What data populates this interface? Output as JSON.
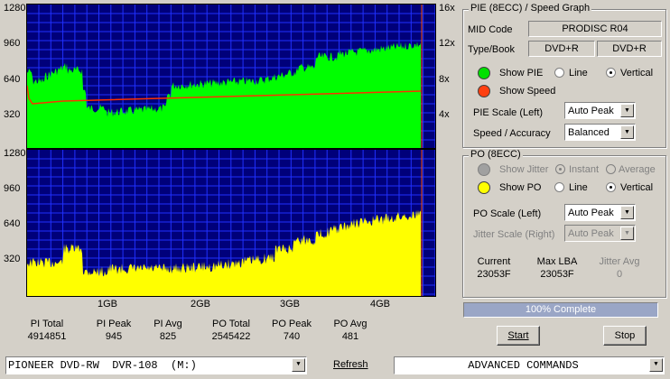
{
  "pie_chart": {
    "y_ticks": [
      "1280",
      "960",
      "640",
      "320"
    ],
    "speed_ticks": [
      "16x",
      "12x",
      "8x",
      "4x"
    ]
  },
  "po_chart": {
    "y_ticks": [
      "1280",
      "960",
      "640",
      "320"
    ]
  },
  "x_ticks": [
    "1GB",
    "2GB",
    "3GB",
    "4GB"
  ],
  "stats": [
    {
      "label": "PI Total",
      "value": "4914851"
    },
    {
      "label": "PI Peak",
      "value": "945"
    },
    {
      "label": "PI Avg",
      "value": "825"
    },
    {
      "label": "PO Total",
      "value": "2545422"
    },
    {
      "label": "PO Peak",
      "value": "740"
    },
    {
      "label": "PO Avg",
      "value": "481"
    }
  ],
  "pie_panel": {
    "title": "PIE (8ECC) / Speed Graph",
    "mid_label": "MID Code",
    "mid_value": "PRODISC R04",
    "type_label": "Type/Book",
    "type_value": "DVD+R",
    "book_value": "DVD+R",
    "show_pie": "Show PIE",
    "show_speed": "Show Speed",
    "line": "Line",
    "vertical": "Vertical",
    "scale_label": "PIE Scale (Left)",
    "scale_value": "Auto Peak",
    "speed_label": "Speed / Accuracy",
    "speed_value": "Balanced"
  },
  "po_panel": {
    "title": "PO (8ECC)",
    "show_jitter": "Show Jitter",
    "instant": "Instant",
    "average": "Average",
    "show_po": "Show PO",
    "line": "Line",
    "vertical": "Vertical",
    "scale_label": "PO Scale (Left)",
    "scale_value": "Auto Peak",
    "jitter_label": "Jitter Scale (Right)",
    "jitter_value": "Auto Peak",
    "current_label": "Current",
    "current_value": "23053F",
    "maxlba_label": "Max LBA",
    "maxlba_value": "23053F",
    "jitteravg_label": "Jitter Avg",
    "jitteravg_value": "0"
  },
  "progress": {
    "text": "100% Complete",
    "fraction": 1.0
  },
  "buttons": {
    "start": "Start",
    "stop": "Stop"
  },
  "bottom": {
    "drive": "PIONEER DVD-RW  DVR-108  (M:)",
    "refresh": "Refresh",
    "commands": "ADVANCED COMMANDS"
  },
  "colors": {
    "pie_fill": "#00ff00",
    "po_fill": "#ffff00",
    "speed_line": "#ff3000",
    "graph_bg": "#00007a",
    "grid": "#2030ff",
    "end_marker": "#ff5000"
  }
}
